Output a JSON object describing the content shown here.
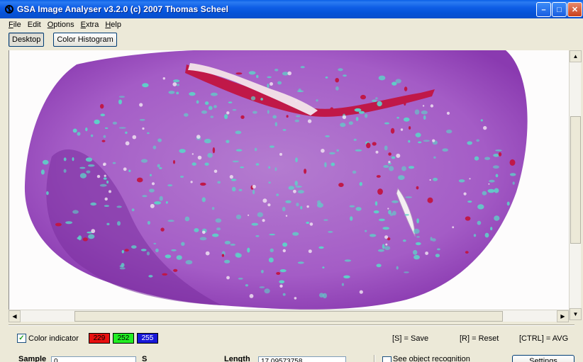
{
  "window": {
    "title": "GSA Image Analyser v3.2.0 (c) 2007  Thomas Scheel",
    "min_symbol": "–",
    "max_symbol": "□",
    "close_symbol": "✕"
  },
  "menu": [
    {
      "accel": "F",
      "rest": "ile"
    },
    {
      "accel": "",
      "rest": "Edit"
    },
    {
      "accel": "O",
      "rest": "ptions"
    },
    {
      "accel": "E",
      "rest": "xtra"
    },
    {
      "accel": "H",
      "rest": "elp"
    }
  ],
  "tabs": [
    {
      "label": "Desktop",
      "active": true
    },
    {
      "label": "Color Histogram",
      "active": false
    }
  ],
  "scroll": {
    "up": "▲",
    "down": "▼",
    "left": "◀",
    "right": "▶"
  },
  "color_indicator": {
    "label": "Color indicator",
    "checked": true,
    "check_mark": "✓",
    "red": "229",
    "green": "252",
    "blue": "255",
    "red_color": "#e81010",
    "green_color": "#22ee22",
    "blue_color": "#1818d8"
  },
  "hints": {
    "save": "[S] = Save",
    "reset": "[R] = Reset",
    "avg": "[CTRL] = AVG"
  },
  "row2": {
    "sample_label": "Sample",
    "sample_value": "0",
    "s_label": "S",
    "length_label": "Length",
    "length_value": "17.09573758",
    "see_object_label": "See object recognition",
    "settings_label": "Settings"
  },
  "colors": {
    "tissue_purple": "#a65cc4",
    "tissue_dark": "#7a2e9e",
    "cyan_spots": "#5fd0c8",
    "vessel_red": "#c01848",
    "background": "#fdfcfc"
  }
}
